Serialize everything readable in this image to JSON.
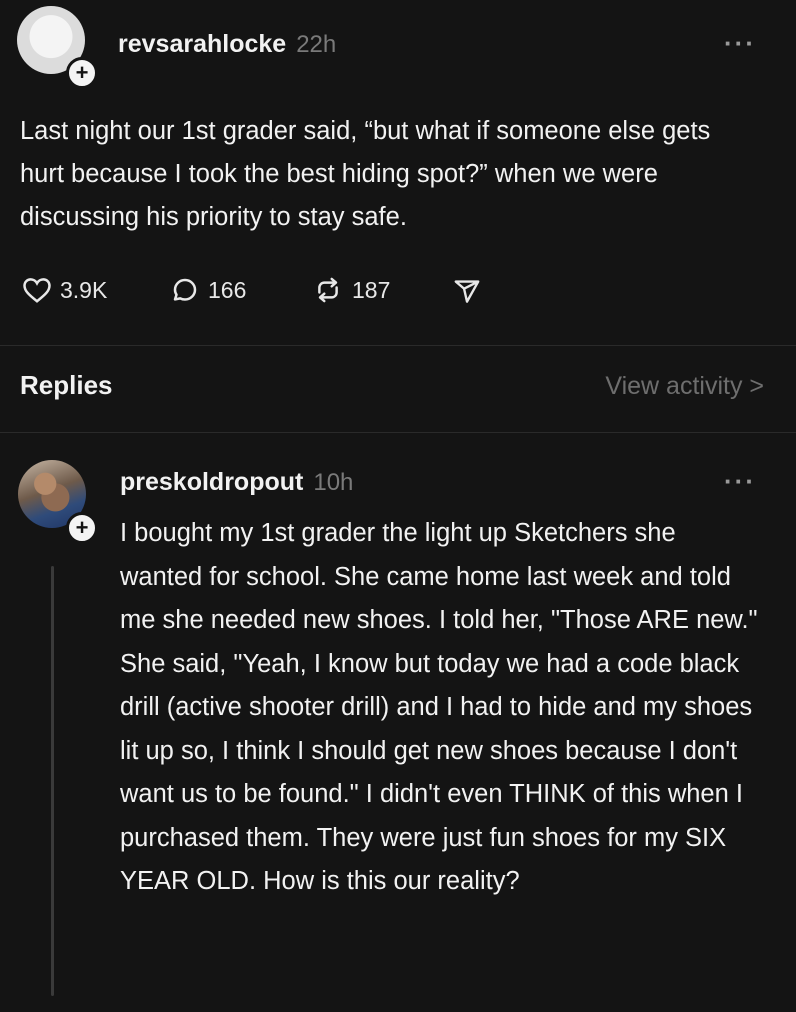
{
  "post": {
    "username": "revsarahlocke",
    "time": "22h",
    "more": "···",
    "text": "Last night our 1st grader said, “but what if someone else gets hurt because I took the best hiding spot?” when we were discussing his priority to stay safe.",
    "likes": "3.9K",
    "comments": "166",
    "reposts": "187"
  },
  "replies_header": {
    "title": "Replies",
    "view_activity": "View activity >"
  },
  "reply": {
    "username": "preskoldropout",
    "time": "10h",
    "more": "···",
    "text": "I bought my 1st grader the light up Sketchers she wanted for school. She came home last week and told me she needed new shoes. I told her, \"Those ARE new.\" She said, \"Yeah, I know but today we had a code black drill (active shooter drill) and I had to hide and my shoes lit up so, I think I should get new shoes because I don't want us to be found.\" I didn't even THINK of this when I purchased them. They were just fun shoes for my SIX YEAR OLD. How is this our reality?"
  },
  "icons": [
    "plus-icon",
    "heart-icon",
    "comment-icon",
    "repost-icon",
    "share-icon",
    "more-icon"
  ]
}
